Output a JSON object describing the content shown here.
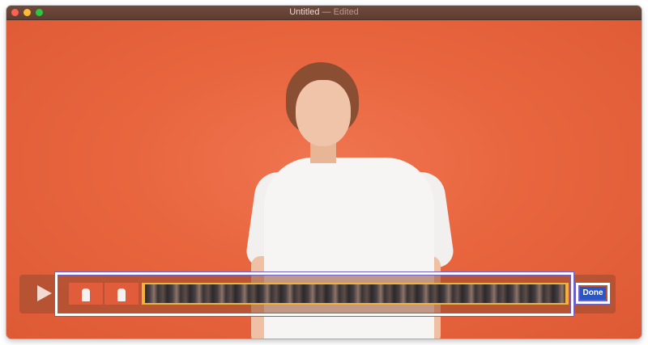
{
  "window": {
    "title": "Untitled",
    "separator": "—",
    "status": "Edited"
  },
  "trim": {
    "done_label": "Done"
  },
  "colors": {
    "background": "#e8653e",
    "selection_border": "#f0b23b",
    "done_button": "#2a55c7",
    "highlight_outline": "#6c63c9"
  }
}
